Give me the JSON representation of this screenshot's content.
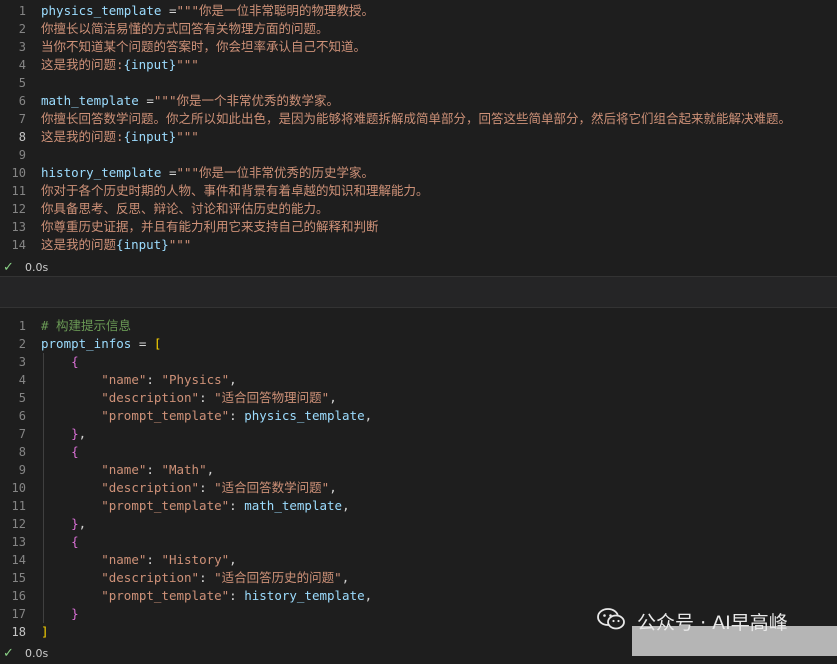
{
  "colors": {
    "var": "#9cdcfe",
    "op": "#d4d4d4",
    "str": "#ce9178",
    "brace": "#9cdcfe",
    "comment": "#6a9955",
    "bracket1": "#ffd700",
    "bracket2": "#da70d6"
  },
  "cell1": {
    "lines": [
      {
        "n": "1",
        "tokens": [
          {
            "t": "physics_template",
            "c": "var"
          },
          {
            "t": " =",
            "c": "op"
          },
          {
            "t": "\"\"\"你是一位非常聪明的物理教授。",
            "c": "str"
          }
        ]
      },
      {
        "n": "2",
        "tokens": [
          {
            "t": "你擅长以简洁易懂的方式回答有关物理方面的问题。",
            "c": "str"
          }
        ]
      },
      {
        "n": "3",
        "tokens": [
          {
            "t": "当你不知道某个问题的答案时，你会坦率承认自己不知道。",
            "c": "str"
          }
        ]
      },
      {
        "n": "4",
        "tokens": [
          {
            "t": "这是我的问题:",
            "c": "str"
          },
          {
            "t": "{input}",
            "c": "brace"
          },
          {
            "t": "\"\"\"",
            "c": "str"
          }
        ]
      },
      {
        "n": "5",
        "tokens": []
      },
      {
        "n": "6",
        "tokens": [
          {
            "t": "math_template",
            "c": "var"
          },
          {
            "t": " =",
            "c": "op"
          },
          {
            "t": "\"\"\"你是一个非常优秀的数学家。",
            "c": "str"
          }
        ]
      },
      {
        "n": "7",
        "tokens": [
          {
            "t": "你擅长回答数学问题。你之所以如此出色，是因为能够将难题拆解成简单部分，回答这些简单部分，然后将它们组合起来就能解决难题。",
            "c": "str"
          }
        ]
      },
      {
        "n": "8",
        "active": true,
        "tokens": [
          {
            "t": "这是我的问题:",
            "c": "str"
          },
          {
            "t": "{input}",
            "c": "brace"
          },
          {
            "t": "\"\"\"",
            "c": "str"
          }
        ]
      },
      {
        "n": "9",
        "tokens": []
      },
      {
        "n": "10",
        "tokens": [
          {
            "t": "history_template",
            "c": "var"
          },
          {
            "t": " =",
            "c": "op"
          },
          {
            "t": "\"\"\"你是一位非常优秀的历史学家。",
            "c": "str"
          }
        ]
      },
      {
        "n": "11",
        "tokens": [
          {
            "t": "你对于各个历史时期的人物、事件和背景有着卓越的知识和理解能力。",
            "c": "str"
          }
        ]
      },
      {
        "n": "12",
        "tokens": [
          {
            "t": "你具备思考、反思、辩论、讨论和评估历史的能力。",
            "c": "str"
          }
        ]
      },
      {
        "n": "13",
        "tokens": [
          {
            "t": "你尊重历史证据，并且有能力利用它来支持自己的解释和判断",
            "c": "str"
          }
        ]
      },
      {
        "n": "14",
        "tokens": [
          {
            "t": "这是我的问题",
            "c": "str"
          },
          {
            "t": "{input}",
            "c": "brace"
          },
          {
            "t": "\"\"\"",
            "c": "str"
          }
        ]
      }
    ],
    "status_time": "0.0s"
  },
  "cell2": {
    "lines": [
      {
        "n": "1",
        "tokens": [
          {
            "t": "# 构建提示信息",
            "c": "comment"
          }
        ]
      },
      {
        "n": "2",
        "tokens": [
          {
            "t": "prompt_infos",
            "c": "var"
          },
          {
            "t": " = ",
            "c": "op"
          },
          {
            "t": "[",
            "c": "bracket1"
          }
        ]
      },
      {
        "n": "3",
        "guide": true,
        "tokens": [
          {
            "t": "    ",
            "c": "op"
          },
          {
            "t": "{",
            "c": "bracket2"
          }
        ]
      },
      {
        "n": "4",
        "guide": true,
        "tokens": [
          {
            "t": "        ",
            "c": "op"
          },
          {
            "t": "\"name\"",
            "c": "str"
          },
          {
            "t": ": ",
            "c": "op"
          },
          {
            "t": "\"Physics\"",
            "c": "str"
          },
          {
            "t": ",",
            "c": "op"
          }
        ]
      },
      {
        "n": "5",
        "guide": true,
        "tokens": [
          {
            "t": "        ",
            "c": "op"
          },
          {
            "t": "\"description\"",
            "c": "str"
          },
          {
            "t": ": ",
            "c": "op"
          },
          {
            "t": "\"适合回答物理问题\"",
            "c": "str"
          },
          {
            "t": ",",
            "c": "op"
          }
        ]
      },
      {
        "n": "6",
        "guide": true,
        "tokens": [
          {
            "t": "        ",
            "c": "op"
          },
          {
            "t": "\"prompt_template\"",
            "c": "str"
          },
          {
            "t": ": ",
            "c": "op"
          },
          {
            "t": "physics_template",
            "c": "var"
          },
          {
            "t": ",",
            "c": "op"
          }
        ]
      },
      {
        "n": "7",
        "guide": true,
        "tokens": [
          {
            "t": "    ",
            "c": "op"
          },
          {
            "t": "}",
            "c": "bracket2"
          },
          {
            "t": ",",
            "c": "op"
          }
        ]
      },
      {
        "n": "8",
        "guide": true,
        "tokens": [
          {
            "t": "    ",
            "c": "op"
          },
          {
            "t": "{",
            "c": "bracket2"
          }
        ]
      },
      {
        "n": "9",
        "guide": true,
        "tokens": [
          {
            "t": "        ",
            "c": "op"
          },
          {
            "t": "\"name\"",
            "c": "str"
          },
          {
            "t": ": ",
            "c": "op"
          },
          {
            "t": "\"Math\"",
            "c": "str"
          },
          {
            "t": ",",
            "c": "op"
          }
        ]
      },
      {
        "n": "10",
        "guide": true,
        "tokens": [
          {
            "t": "        ",
            "c": "op"
          },
          {
            "t": "\"description\"",
            "c": "str"
          },
          {
            "t": ": ",
            "c": "op"
          },
          {
            "t": "\"适合回答数学问题\"",
            "c": "str"
          },
          {
            "t": ",",
            "c": "op"
          }
        ]
      },
      {
        "n": "11",
        "guide": true,
        "tokens": [
          {
            "t": "        ",
            "c": "op"
          },
          {
            "t": "\"prompt_template\"",
            "c": "str"
          },
          {
            "t": ": ",
            "c": "op"
          },
          {
            "t": "math_template",
            "c": "var"
          },
          {
            "t": ",",
            "c": "op"
          }
        ]
      },
      {
        "n": "12",
        "guide": true,
        "tokens": [
          {
            "t": "    ",
            "c": "op"
          },
          {
            "t": "}",
            "c": "bracket2"
          },
          {
            "t": ",",
            "c": "op"
          }
        ]
      },
      {
        "n": "13",
        "guide": true,
        "tokens": [
          {
            "t": "    ",
            "c": "op"
          },
          {
            "t": "{",
            "c": "bracket2"
          }
        ]
      },
      {
        "n": "14",
        "guide": true,
        "tokens": [
          {
            "t": "        ",
            "c": "op"
          },
          {
            "t": "\"name\"",
            "c": "str"
          },
          {
            "t": ": ",
            "c": "op"
          },
          {
            "t": "\"History\"",
            "c": "str"
          },
          {
            "t": ",",
            "c": "op"
          }
        ]
      },
      {
        "n": "15",
        "guide": true,
        "tokens": [
          {
            "t": "        ",
            "c": "op"
          },
          {
            "t": "\"description\"",
            "c": "str"
          },
          {
            "t": ": ",
            "c": "op"
          },
          {
            "t": "\"适合回答历史的问题\"",
            "c": "str"
          },
          {
            "t": ",",
            "c": "op"
          }
        ]
      },
      {
        "n": "16",
        "guide": true,
        "tokens": [
          {
            "t": "        ",
            "c": "op"
          },
          {
            "t": "\"prompt_template\"",
            "c": "str"
          },
          {
            "t": ": ",
            "c": "op"
          },
          {
            "t": "history_template",
            "c": "var"
          },
          {
            "t": ",",
            "c": "op"
          }
        ]
      },
      {
        "n": "17",
        "guide": true,
        "tokens": [
          {
            "t": "    ",
            "c": "op"
          },
          {
            "t": "}",
            "c": "bracket2"
          }
        ]
      },
      {
        "n": "18",
        "active": true,
        "tokens": [
          {
            "t": "]",
            "c": "bracket1"
          }
        ]
      }
    ],
    "status_time": "0.0s"
  },
  "watermark": {
    "icon": "wechat-icon",
    "text": "公众号 · AI早高峰"
  }
}
